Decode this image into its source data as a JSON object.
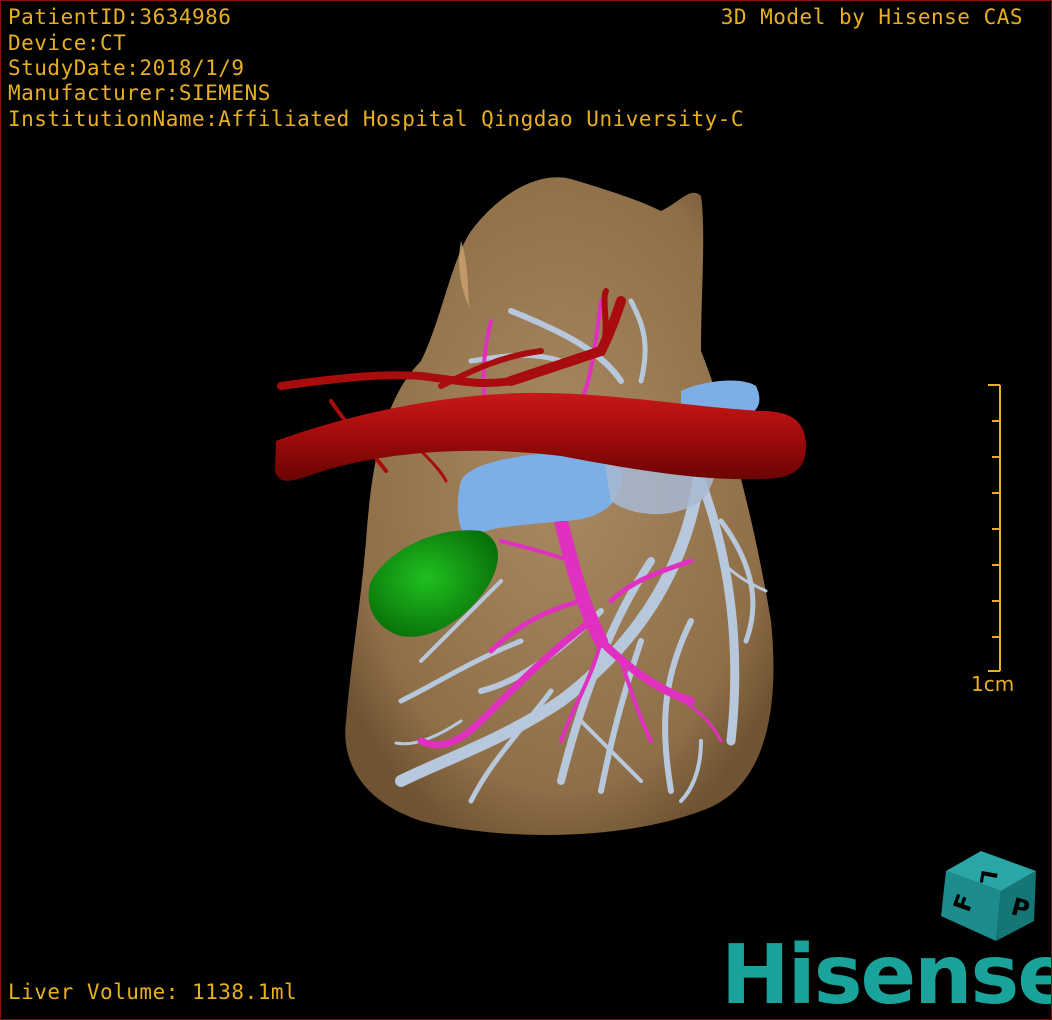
{
  "header": {
    "patient_id": "PatientID:3634986",
    "device": "Device:CT",
    "study_date": "StudyDate:2018/1/9",
    "manufacturer": "Manufacturer:SIEMENS",
    "institution": "InstitutionName:Affiliated Hospital Qingdao University-C"
  },
  "credit": "3D Model by Hisense CAS",
  "footer": {
    "liver_volume": "Liver Volume: 1138.1ml"
  },
  "scale_bar": {
    "label": "1cm"
  },
  "orientation_cube": {
    "faces": [
      "L",
      "P",
      "F"
    ]
  },
  "brand": {
    "logo_text": "Hisense"
  },
  "colors": {
    "text": "#e8b020",
    "liver": "#9b7a52",
    "artery": "#a80c0c",
    "portal_vein": "#e030c0",
    "hepatic_vein": "#b8c8dc",
    "ivc": "#7eaee6",
    "gallbladder": "#12a012",
    "logo": "#1aa39a"
  }
}
